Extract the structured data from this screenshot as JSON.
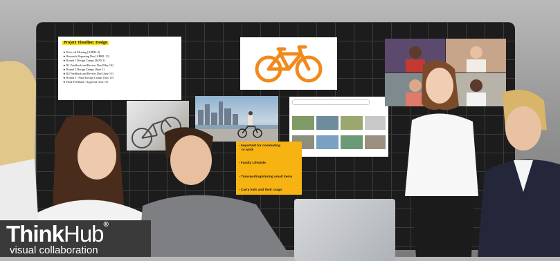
{
  "timeline_card": {
    "title": "Project Timeline: Design",
    "items": [
      "Kick-off Meeting [APRIL 4]",
      "Research Reporting Due [APRIL 15]",
      "Round 1 Design Comps [MAY 1]",
      "R1 Feedback and Review Due [May 10]",
      "Round 2 Design Comps [June 1]",
      "R2 Feedback and Review Due [June 15]",
      "Round 3 / Final Design Comps [July 10]",
      "Final Feedback / Approval [July 15]"
    ]
  },
  "notes_card": {
    "items": [
      "- Important for commuting",
      "to work",
      "- Family Lifestyle",
      "- Transporting/storing small items",
      "- Carry kids and their cargo"
    ]
  },
  "logo": {
    "think": "Think",
    "hub": "Hub",
    "reg": "®",
    "tagline": "visual collaboration"
  },
  "colors": {
    "board": "#1c1c1c",
    "bike_icon": "#f08a1c",
    "sticky_note": "#f6b312",
    "logo_bg": "#3a3a3a"
  },
  "icons": [
    "bicycle-icon",
    "google-logo-icon"
  ]
}
